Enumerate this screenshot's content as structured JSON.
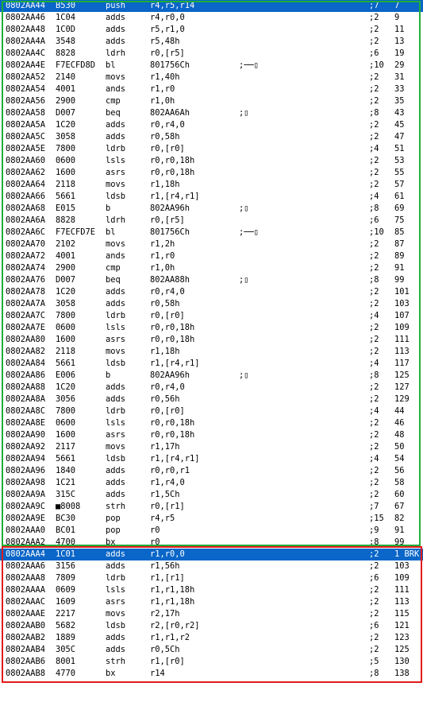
{
  "rows": [
    {
      "addr": "0802AA44",
      "hex": "B530",
      "mn": "push",
      "op": "r4,r5,r14",
      "cm": "",
      "cyc": ";7",
      "tot": "7",
      "selected": true
    },
    {
      "addr": "0802AA46",
      "hex": "1C04",
      "mn": "adds",
      "op": "r4,r0,0",
      "cm": "",
      "cyc": ";2",
      "tot": "9"
    },
    {
      "addr": "0802AA48",
      "hex": "1C0D",
      "mn": "adds",
      "op": "r5,r1,0",
      "cm": "",
      "cyc": ";2",
      "tot": "11"
    },
    {
      "addr": "0802AA4A",
      "hex": "3548",
      "mn": "adds",
      "op": "r5,48h",
      "cm": "",
      "cyc": ";2",
      "tot": "13"
    },
    {
      "addr": "0802AA4C",
      "hex": "8828",
      "mn": "ldrh",
      "op": "r0,[r5]",
      "cm": "",
      "cyc": ";6",
      "tot": "19"
    },
    {
      "addr": "0802AA4E",
      "hex": "F7ECFD8D",
      "mn": "bl",
      "op": "801756Ch",
      "cm": ";──▯",
      "cyc": ";10",
      "tot": "29"
    },
    {
      "addr": "0802AA52",
      "hex": "2140",
      "mn": "movs",
      "op": "r1,40h",
      "cm": "",
      "cyc": ";2",
      "tot": "31"
    },
    {
      "addr": "0802AA54",
      "hex": "4001",
      "mn": "ands",
      "op": "r1,r0",
      "cm": "",
      "cyc": ";2",
      "tot": "33"
    },
    {
      "addr": "0802AA56",
      "hex": "2900",
      "mn": "cmp",
      "op": "r1,0h",
      "cm": "",
      "cyc": ";2",
      "tot": "35"
    },
    {
      "addr": "0802AA58",
      "hex": "D007",
      "mn": "beq",
      "op": "802AA6Ah",
      "cm": ";▯",
      "cyc": ";8",
      "tot": "43"
    },
    {
      "addr": "0802AA5A",
      "hex": "1C20",
      "mn": "adds",
      "op": "r0,r4,0",
      "cm": "",
      "cyc": ";2",
      "tot": "45"
    },
    {
      "addr": "0802AA5C",
      "hex": "3058",
      "mn": "adds",
      "op": "r0,58h",
      "cm": "",
      "cyc": ";2",
      "tot": "47"
    },
    {
      "addr": "0802AA5E",
      "hex": "7800",
      "mn": "ldrb",
      "op": "r0,[r0]",
      "cm": "",
      "cyc": ";4",
      "tot": "51"
    },
    {
      "addr": "0802AA60",
      "hex": "0600",
      "mn": "lsls",
      "op": "r0,r0,18h",
      "cm": "",
      "cyc": ";2",
      "tot": "53"
    },
    {
      "addr": "0802AA62",
      "hex": "1600",
      "mn": "asrs",
      "op": "r0,r0,18h",
      "cm": "",
      "cyc": ";2",
      "tot": "55"
    },
    {
      "addr": "0802AA64",
      "hex": "2118",
      "mn": "movs",
      "op": "r1,18h",
      "cm": "",
      "cyc": ";2",
      "tot": "57"
    },
    {
      "addr": "0802AA66",
      "hex": "5661",
      "mn": "ldsb",
      "op": "r1,[r4,r1]",
      "cm": "",
      "cyc": ";4",
      "tot": "61"
    },
    {
      "addr": "0802AA68",
      "hex": "E015",
      "mn": "b",
      "op": "802AA96h",
      "cm": ";▯",
      "cyc": ";8",
      "tot": "69"
    },
    {
      "addr": "0802AA6A",
      "hex": "8828",
      "mn": "ldrh",
      "op": "r0,[r5]",
      "cm": "",
      "cyc": ";6",
      "tot": "75"
    },
    {
      "addr": "0802AA6C",
      "hex": "F7ECFD7E",
      "mn": "bl",
      "op": "801756Ch",
      "cm": ";──▯",
      "cyc": ";10",
      "tot": "85"
    },
    {
      "addr": "0802AA70",
      "hex": "2102",
      "mn": "movs",
      "op": "r1,2h",
      "cm": "",
      "cyc": ";2",
      "tot": "87"
    },
    {
      "addr": "0802AA72",
      "hex": "4001",
      "mn": "ands",
      "op": "r1,r0",
      "cm": "",
      "cyc": ";2",
      "tot": "89"
    },
    {
      "addr": "0802AA74",
      "hex": "2900",
      "mn": "cmp",
      "op": "r1,0h",
      "cm": "",
      "cyc": ";2",
      "tot": "91"
    },
    {
      "addr": "0802AA76",
      "hex": "D007",
      "mn": "beq",
      "op": "802AA88h",
      "cm": ";▯",
      "cyc": ";8",
      "tot": "99"
    },
    {
      "addr": "0802AA78",
      "hex": "1C20",
      "mn": "adds",
      "op": "r0,r4,0",
      "cm": "",
      "cyc": ";2",
      "tot": "101"
    },
    {
      "addr": "0802AA7A",
      "hex": "3058",
      "mn": "adds",
      "op": "r0,58h",
      "cm": "",
      "cyc": ";2",
      "tot": "103"
    },
    {
      "addr": "0802AA7C",
      "hex": "7800",
      "mn": "ldrb",
      "op": "r0,[r0]",
      "cm": "",
      "cyc": ";4",
      "tot": "107"
    },
    {
      "addr": "0802AA7E",
      "hex": "0600",
      "mn": "lsls",
      "op": "r0,r0,18h",
      "cm": "",
      "cyc": ";2",
      "tot": "109"
    },
    {
      "addr": "0802AA80",
      "hex": "1600",
      "mn": "asrs",
      "op": "r0,r0,18h",
      "cm": "",
      "cyc": ";2",
      "tot": "111"
    },
    {
      "addr": "0802AA82",
      "hex": "2118",
      "mn": "movs",
      "op": "r1,18h",
      "cm": "",
      "cyc": ";2",
      "tot": "113"
    },
    {
      "addr": "0802AA84",
      "hex": "5661",
      "mn": "ldsb",
      "op": "r1,[r4,r1]",
      "cm": "",
      "cyc": ";4",
      "tot": "117"
    },
    {
      "addr": "0802AA86",
      "hex": "E006",
      "mn": "b",
      "op": "802AA96h",
      "cm": ";▯",
      "cyc": ";8",
      "tot": "125"
    },
    {
      "addr": "0802AA88",
      "hex": "1C20",
      "mn": "adds",
      "op": "r0,r4,0",
      "cm": "",
      "cyc": ";2",
      "tot": "127"
    },
    {
      "addr": "0802AA8A",
      "hex": "3056",
      "mn": "adds",
      "op": "r0,56h",
      "cm": "",
      "cyc": ";2",
      "tot": "129"
    },
    {
      "addr": "0802AA8C",
      "hex": "7800",
      "mn": "ldrb",
      "op": "r0,[r0]",
      "cm": "",
      "cyc": ";4",
      "tot": "44"
    },
    {
      "addr": "0802AA8E",
      "hex": "0600",
      "mn": "lsls",
      "op": "r0,r0,18h",
      "cm": "",
      "cyc": ";2",
      "tot": "46"
    },
    {
      "addr": "0802AA90",
      "hex": "1600",
      "mn": "asrs",
      "op": "r0,r0,18h",
      "cm": "",
      "cyc": ";2",
      "tot": "48"
    },
    {
      "addr": "0802AA92",
      "hex": "2117",
      "mn": "movs",
      "op": "r1,17h",
      "cm": "",
      "cyc": ";2",
      "tot": "50"
    },
    {
      "addr": "0802AA94",
      "hex": "5661",
      "mn": "ldsb",
      "op": "r1,[r4,r1]",
      "cm": "",
      "cyc": ";4",
      "tot": "54"
    },
    {
      "addr": "0802AA96",
      "hex": "1840",
      "mn": "adds",
      "op": "r0,r0,r1",
      "cm": "",
      "cyc": ";2",
      "tot": "56"
    },
    {
      "addr": "0802AA98",
      "hex": "1C21",
      "mn": "adds",
      "op": "r1,r4,0",
      "cm": "",
      "cyc": ";2",
      "tot": "58"
    },
    {
      "addr": "0802AA9A",
      "hex": "315C",
      "mn": "adds",
      "op": "r1,5Ch",
      "cm": "",
      "cyc": ";2",
      "tot": "60"
    },
    {
      "addr": "0802AA9C",
      "hex": "■8008",
      "mn": "strh",
      "op": "r0,[r1]",
      "cm": "",
      "cyc": ";7",
      "tot": "67"
    },
    {
      "addr": "0802AA9E",
      "hex": "BC30",
      "mn": "pop",
      "op": "r4,r5",
      "cm": "",
      "cyc": ";15",
      "tot": "82"
    },
    {
      "addr": "0802AAA0",
      "hex": "BC01",
      "mn": "pop",
      "op": "r0",
      "cm": "",
      "cyc": ";9",
      "tot": "91"
    },
    {
      "addr": "0802AAA2",
      "hex": "4700",
      "mn": "bx",
      "op": "r0",
      "cm": "",
      "cyc": ";8",
      "tot": "99"
    },
    {
      "addr": "0802AAA4",
      "hex": "1C01",
      "mn": "adds",
      "op": "r1,r0,0",
      "cm": "",
      "cyc": ";2",
      "tot": "1 BRK",
      "selected": true
    },
    {
      "addr": "0802AAA6",
      "hex": "3156",
      "mn": "adds",
      "op": "r1,56h",
      "cm": "",
      "cyc": ";2",
      "tot": "103"
    },
    {
      "addr": "0802AAA8",
      "hex": "7809",
      "mn": "ldrb",
      "op": "r1,[r1]",
      "cm": "",
      "cyc": ";6",
      "tot": "109"
    },
    {
      "addr": "0802AAAA",
      "hex": "0609",
      "mn": "lsls",
      "op": "r1,r1,18h",
      "cm": "",
      "cyc": ";2",
      "tot": "111"
    },
    {
      "addr": "0802AAAC",
      "hex": "1609",
      "mn": "asrs",
      "op": "r1,r1,18h",
      "cm": "",
      "cyc": ";2",
      "tot": "113"
    },
    {
      "addr": "0802AAAE",
      "hex": "2217",
      "mn": "movs",
      "op": "r2,17h",
      "cm": "",
      "cyc": ";2",
      "tot": "115"
    },
    {
      "addr": "0802AAB0",
      "hex": "5682",
      "mn": "ldsb",
      "op": "r2,[r0,r2]",
      "cm": "",
      "cyc": ";6",
      "tot": "121"
    },
    {
      "addr": "0802AAB2",
      "hex": "1889",
      "mn": "adds",
      "op": "r1,r1,r2",
      "cm": "",
      "cyc": ";2",
      "tot": "123"
    },
    {
      "addr": "0802AAB4",
      "hex": "305C",
      "mn": "adds",
      "op": "r0,5Ch",
      "cm": "",
      "cyc": ";2",
      "tot": "125"
    },
    {
      "addr": "0802AAB6",
      "hex": "8001",
      "mn": "strh",
      "op": "r1,[r0]",
      "cm": "",
      "cyc": ";5",
      "tot": "130"
    },
    {
      "addr": "0802AAB8",
      "hex": "4770",
      "mn": "bx",
      "op": "r14",
      "cm": "",
      "cyc": ";8",
      "tot": "138"
    }
  ],
  "colors": {
    "selection": "#0a66c8",
    "green_frame": "#1fad3a",
    "red_frame": "#e01b1b"
  }
}
